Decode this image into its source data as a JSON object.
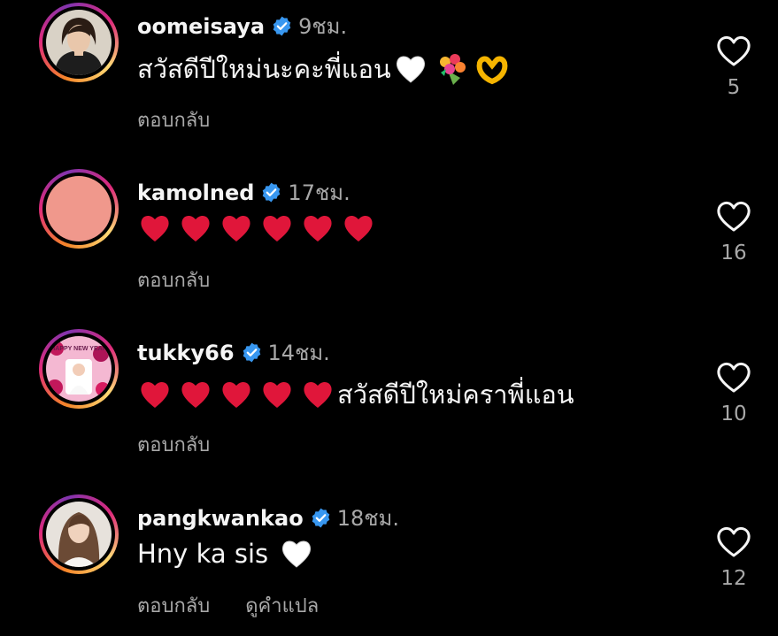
{
  "comments": [
    {
      "username": "oomeisaya",
      "time": "9ชม.",
      "text": "สวัสดีปีใหม่นะคะพี่แอน",
      "emojis": [
        "white-heart",
        "bouquet",
        "heart-hands"
      ],
      "actions": [
        "ตอบกลับ"
      ],
      "likes": "5"
    },
    {
      "username": "kamolned",
      "time": "17ชม.",
      "text": "",
      "emojis": [
        "red-heart",
        "red-heart",
        "red-heart",
        "red-heart",
        "red-heart",
        "red-heart"
      ],
      "actions": [
        "ตอบกลับ"
      ],
      "likes": "16"
    },
    {
      "username": "tukky66",
      "time": "14ชม.",
      "text": "สวัสดีปีใหม่คราพี่แอน",
      "emojis": [
        "red-heart",
        "red-heart",
        "red-heart",
        "red-heart",
        "red-heart"
      ],
      "actions": [
        "ตอบกลับ"
      ],
      "likes": "10"
    },
    {
      "username": "pangkwankao",
      "time": "18ชม.",
      "text": "Hny ka sis",
      "emojis": [
        "white-heart"
      ],
      "actions": [
        "ตอบกลับ",
        "ดูคำแปล"
      ],
      "likes": "12"
    }
  ],
  "colors": {
    "background": "#000000",
    "text": "#f5f5f5",
    "muted": "#a8a8a8",
    "verified": "#3897f0",
    "heart": "#e0163a"
  },
  "avatar_badge": "HAPPY NEW YEAR"
}
